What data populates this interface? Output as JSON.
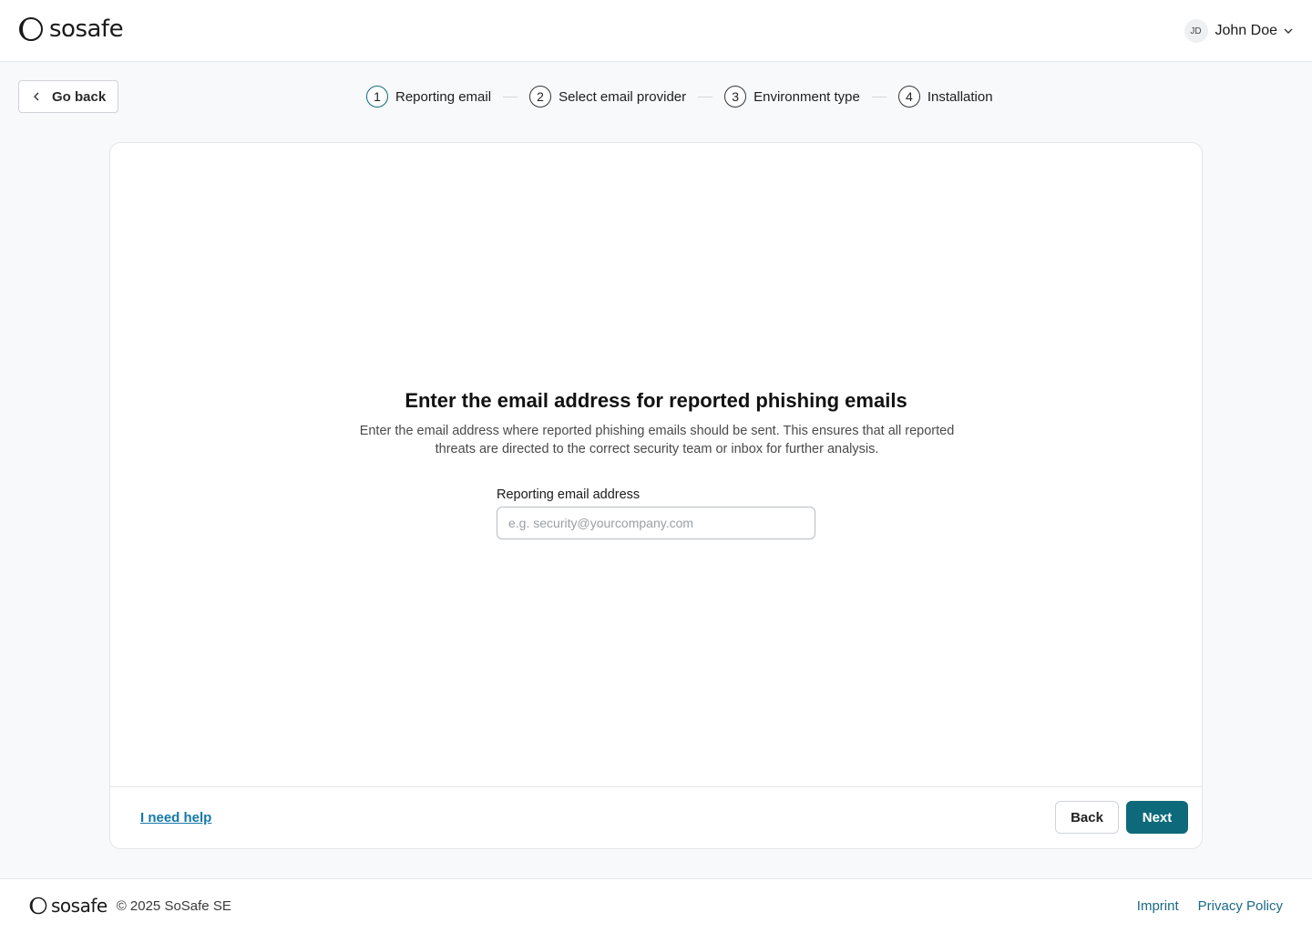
{
  "header": {
    "brand": "sosafe",
    "user": {
      "initials": "JD",
      "name": "John Doe"
    }
  },
  "nav": {
    "go_back_label": "Go back"
  },
  "stepper": {
    "steps": [
      {
        "number": "1",
        "label": "Reporting email",
        "active": true
      },
      {
        "number": "2",
        "label": "Select email provider",
        "active": false
      },
      {
        "number": "3",
        "label": "Environment type",
        "active": false
      },
      {
        "number": "4",
        "label": "Installation",
        "active": false
      }
    ]
  },
  "card": {
    "title": "Enter the email address for reported phishing emails",
    "description": "Enter the email address where reported phishing emails should be sent. This ensures that all reported threats are directed to the correct security team or inbox for further analysis.",
    "field": {
      "label": "Reporting email address",
      "value": "",
      "placeholder": "e.g. security@yourcompany.com"
    },
    "help_link": "I need help",
    "back_button": "Back",
    "next_button": "Next"
  },
  "footer": {
    "brand": "sosafe",
    "copyright": "© 2025 SoSafe SE",
    "links": [
      "Imprint",
      "Privacy Policy"
    ]
  },
  "colors": {
    "accent": "#0e6a7b",
    "link": "#1579a8",
    "background": "#f8f9fb"
  }
}
